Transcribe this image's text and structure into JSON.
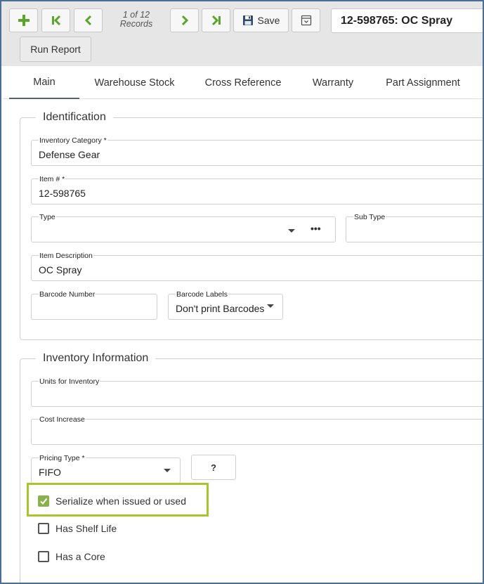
{
  "toolbar": {
    "record_position": "1 of 12",
    "record_label": "Records",
    "save_label": "Save",
    "record_title": "12-598765: OC Spray",
    "run_report_label": "Run Report",
    "accent_color": "#5aa52b"
  },
  "tabs": [
    {
      "label": "Main",
      "active": true
    },
    {
      "label": "Warehouse Stock"
    },
    {
      "label": "Cross Reference"
    },
    {
      "label": "Warranty"
    },
    {
      "label": "Part Assignment"
    }
  ],
  "identification": {
    "legend": "Identification",
    "inventory_category": {
      "label": "Inventory Category *",
      "value": "Defense Gear"
    },
    "item_number": {
      "label": "Item # *",
      "value": "12-598765"
    },
    "type": {
      "label": "Type",
      "value": ""
    },
    "sub_type": {
      "label": "Sub Type",
      "value": ""
    },
    "item_description": {
      "label": "Item Description",
      "value": "OC Spray"
    },
    "barcode_number": {
      "label": "Barcode Number",
      "value": ""
    },
    "barcode_labels": {
      "label": "Barcode Labels",
      "value": "Don't print Barcodes"
    }
  },
  "inventory_information": {
    "legend": "Inventory Information",
    "units_for_inventory": {
      "label": "Units for Inventory",
      "value": ""
    },
    "cost_increase": {
      "label": "Cost Increase",
      "value": ""
    },
    "pricing_type": {
      "label": "Pricing Type *",
      "value": "FIFO"
    },
    "help_button": "?",
    "checkboxes": [
      {
        "label": "Serialize when issued or used",
        "checked": true
      },
      {
        "label": "Has Shelf Life",
        "checked": false
      },
      {
        "label": "Has a Core",
        "checked": false
      }
    ],
    "highlight_color": "#a8c52e"
  }
}
